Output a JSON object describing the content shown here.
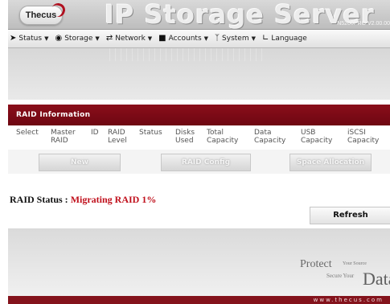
{
  "header": {
    "logo": "Thecus",
    "product": "IP Storage Server",
    "model": "N5200PRO V2.00.00"
  },
  "nav": [
    {
      "label": "Status",
      "icon": "status-icon"
    },
    {
      "label": "Storage",
      "icon": "storage-icon"
    },
    {
      "label": "Network",
      "icon": "network-icon"
    },
    {
      "label": "Accounts",
      "icon": "accounts-icon"
    },
    {
      "label": "System",
      "icon": "system-icon"
    },
    {
      "label": "Language",
      "icon": "language-icon"
    }
  ],
  "raid": {
    "title": "RAID Information",
    "columns": [
      "Select",
      "Master RAID",
      "ID",
      "RAID Level",
      "Status",
      "Disks Used",
      "Total Capacity",
      "Data Capacity",
      "USB Capacity",
      "iSCSI Capacity"
    ],
    "buttons": {
      "new": "New",
      "config": "RAID Config",
      "space": "Space Allocation"
    }
  },
  "status": {
    "label": "RAID Status : ",
    "value": "Migrating RAID 1%"
  },
  "actions": {
    "refresh": "Refresh"
  },
  "slogan": {
    "protect": "Protect",
    "your_source": "Your Source",
    "secure_your": "Secure Your",
    "data": "Data"
  },
  "footer": {
    "url": "www.thecus.com"
  },
  "colors": {
    "brand_red": "#8a0e1a",
    "status_red": "#c0101c"
  }
}
